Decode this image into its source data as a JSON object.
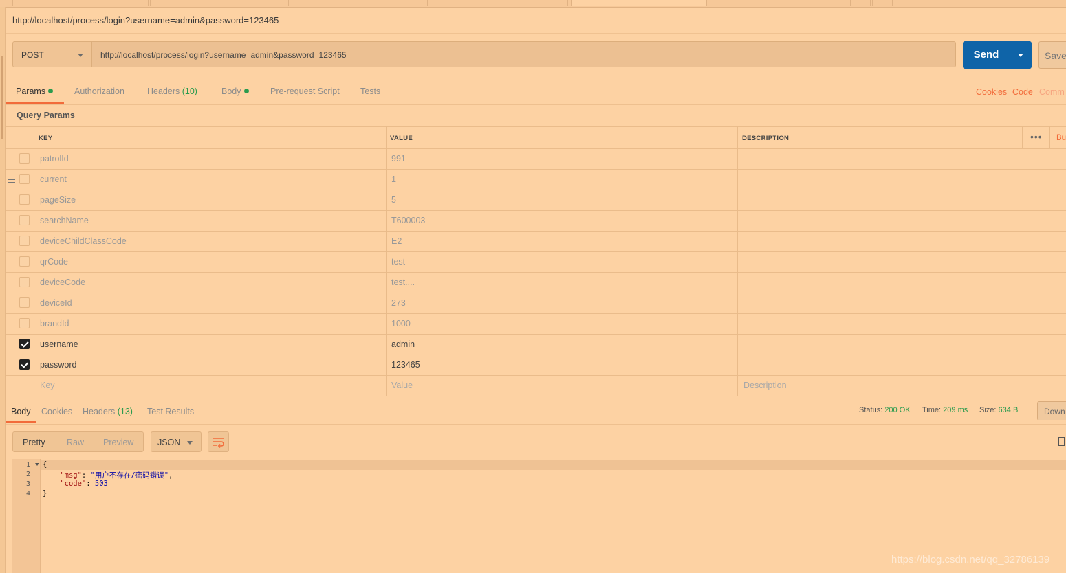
{
  "request": {
    "name": "http://localhost/process/login?username=admin&password=123465",
    "method": "POST",
    "url": "http://localhost/process/login?username=admin&password=123465",
    "send_label": "Send",
    "save_label": "Save"
  },
  "tabs": {
    "params": "Params",
    "authorization": "Authorization",
    "headers": "Headers",
    "headers_count": "(10)",
    "body": "Body",
    "prerequest": "Pre-request Script",
    "tests": "Tests",
    "cookies": "Cookies",
    "code": "Code",
    "comments": "Comm"
  },
  "query_params": {
    "title": "Query Params",
    "columns": {
      "key": "KEY",
      "value": "VALUE",
      "description": "DESCRIPTION"
    },
    "more": "•••",
    "bulk": "Bu",
    "rows": [
      {
        "key": "patrolId",
        "value": "991",
        "checked": false
      },
      {
        "key": "current",
        "value": "1",
        "checked": false
      },
      {
        "key": "pageSize",
        "value": "5",
        "checked": false
      },
      {
        "key": "searchName",
        "value": "T600003",
        "checked": false
      },
      {
        "key": "deviceChildClassCode",
        "value": "E2",
        "checked": false
      },
      {
        "key": "qrCode",
        "value": "test",
        "checked": false
      },
      {
        "key": "deviceCode",
        "value": "test....",
        "checked": false
      },
      {
        "key": "deviceId",
        "value": "273",
        "checked": false
      },
      {
        "key": "brandId",
        "value": "1000",
        "checked": false
      },
      {
        "key": "username",
        "value": "admin",
        "checked": true
      },
      {
        "key": "password",
        "value": "123465",
        "checked": true
      }
    ],
    "placeholder": {
      "key": "Key",
      "value": "Value",
      "description": "Description"
    }
  },
  "response": {
    "tabs": {
      "body": "Body",
      "cookies": "Cookies",
      "headers": "Headers",
      "headers_count": "(13)",
      "tests": "Test Results"
    },
    "status_label": "Status:",
    "status": "200 OK",
    "time_label": "Time:",
    "time": "209 ms",
    "size_label": "Size:",
    "size": "634 B",
    "download": "Down",
    "formats": {
      "pretty": "Pretty",
      "raw": "Raw",
      "preview": "Preview"
    },
    "language": "JSON",
    "lines": [
      "1",
      "2",
      "3",
      "4"
    ],
    "code": {
      "open": "{",
      "msg_key": "\"msg\"",
      "msg_value": "\"用户不存在/密码错误\"",
      "code_key": "\"code\"",
      "code_value": "503",
      "close": "}"
    }
  },
  "watermark": "https://blog.csdn.net/qq_32786139",
  "colors": {
    "background": "#fdd2a3",
    "accent": "#f26b3a",
    "send": "#0f64a8",
    "success": "#2a9b4e"
  }
}
